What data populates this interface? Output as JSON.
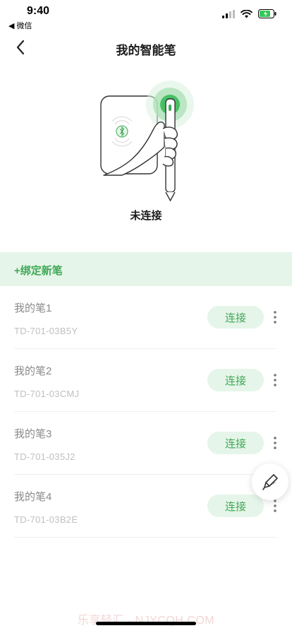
{
  "status_bar": {
    "time": "9:40",
    "back_app": "◀ 微信"
  },
  "nav": {
    "title": "我的智能笔"
  },
  "device": {
    "connection_status": "未连接"
  },
  "bind": {
    "label": "+绑定新笔"
  },
  "pens": [
    {
      "name": "我的笔1",
      "serial": "TD-701-03B5Y",
      "action": "连接"
    },
    {
      "name": "我的笔2",
      "serial": "TD-701-03CMJ",
      "action": "连接"
    },
    {
      "name": "我的笔3",
      "serial": "TD-701-035J2",
      "action": "连接"
    },
    {
      "name": "我的笔4",
      "serial": "TD-701-03B2E",
      "action": "连接"
    }
  ],
  "watermark": "乐享轻汇 · NJYCQH.COM",
  "colors": {
    "accent": "#3fa956",
    "accent_light": "#e6f5e9"
  },
  "icons": [
    "back-chevron-icon",
    "bluetooth-icon",
    "more-vertical-icon",
    "pen-icon",
    "signal-icon",
    "wifi-icon",
    "battery-icon"
  ]
}
